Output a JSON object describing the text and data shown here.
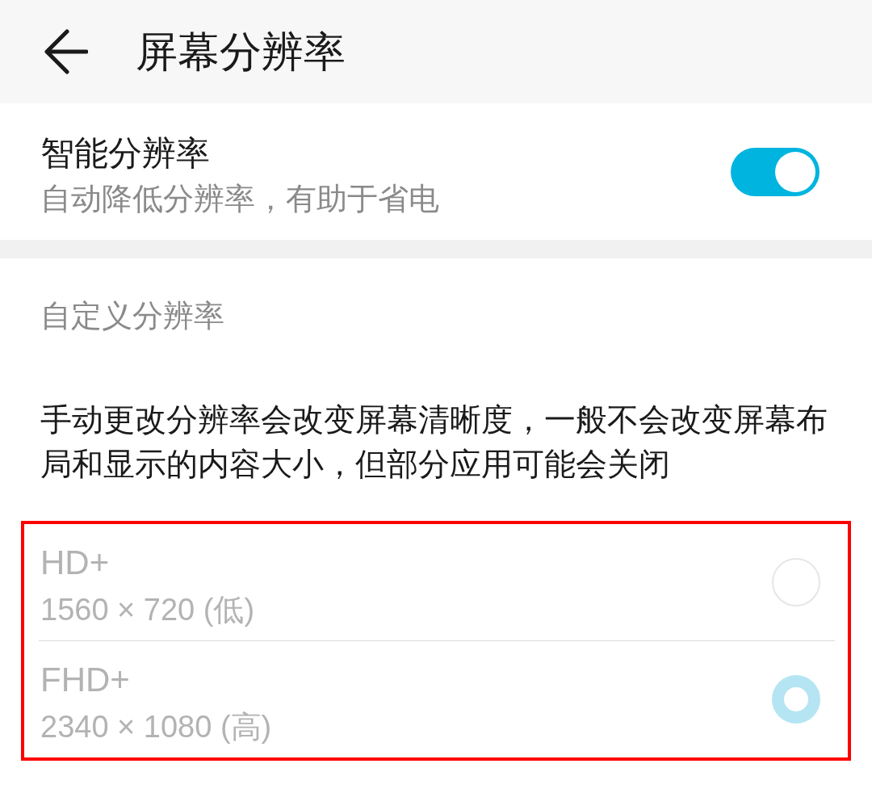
{
  "header": {
    "title": "屏幕分辨率"
  },
  "smart_resolution": {
    "title": "智能分辨率",
    "subtitle": "自动降低分辨率，有助于省电",
    "on": true
  },
  "custom_resolution": {
    "heading": "自定义分辨率",
    "description": "手动更改分辨率会改变屏幕清晰度，一般不会改变屏幕布局和显示的内容大小，但部分应用可能会关闭",
    "options": [
      {
        "label": "HD+",
        "detail": "1560 × 720 (低)",
        "selected": false,
        "disabled": true
      },
      {
        "label": "FHD+",
        "detail": "2340 × 1080 (高)",
        "selected": true,
        "disabled": true
      }
    ]
  }
}
